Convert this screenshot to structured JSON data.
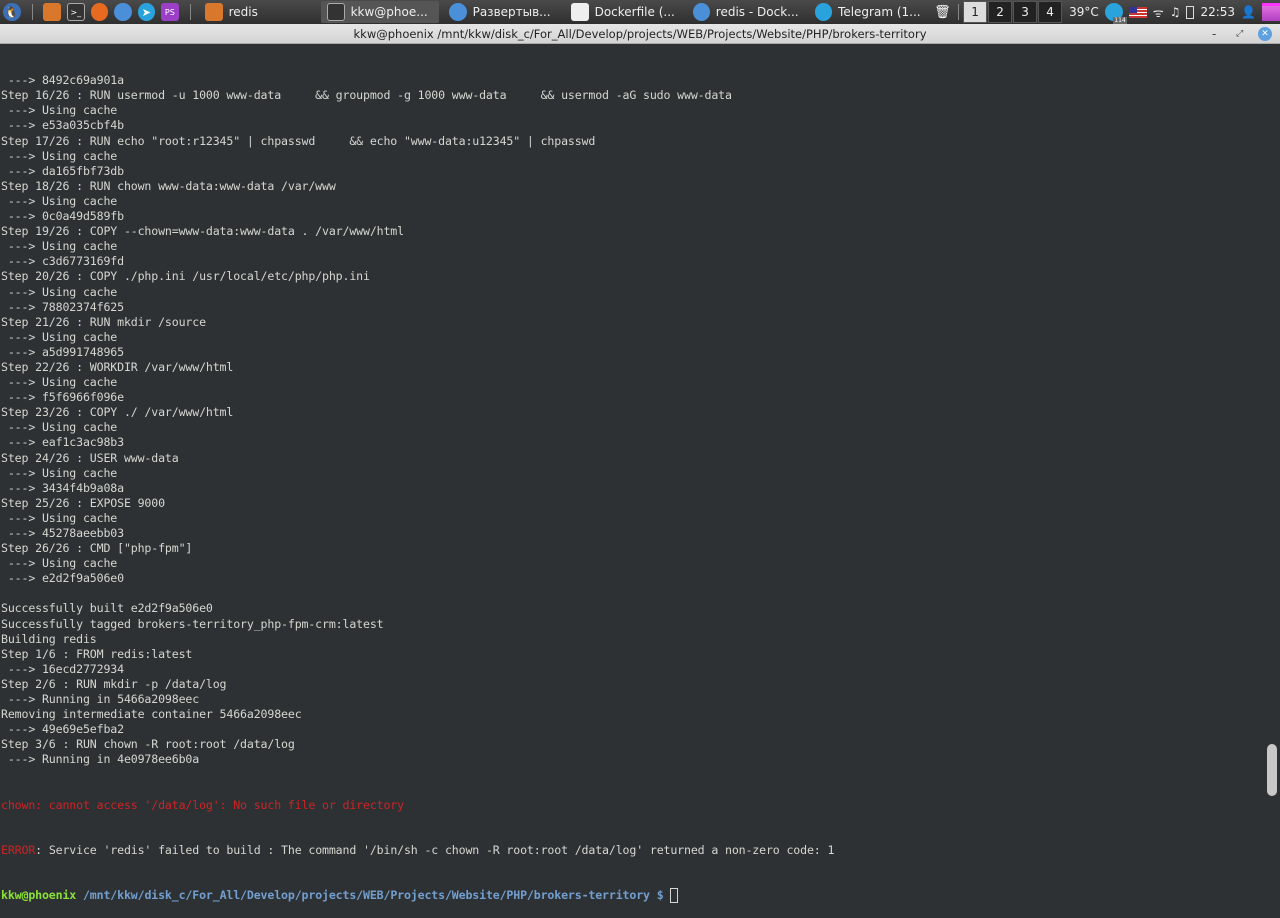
{
  "taskbar": {
    "tasks": [
      {
        "label": "redis",
        "icon": "folder-icon"
      },
      {
        "label": "kkw@phoe...",
        "icon": "terminal-icon",
        "active": true
      },
      {
        "label": "Развертыв...",
        "icon": "chromium-icon"
      },
      {
        "label": "Dockerfile (...",
        "icon": "text-editor-icon"
      },
      {
        "label": "redis - Dock...",
        "icon": "chromium-icon"
      },
      {
        "label": "Telegram (1...",
        "icon": "telegram-icon"
      }
    ],
    "workspaces": [
      "1",
      "2",
      "3",
      "4"
    ],
    "current_workspace": "1",
    "temperature": "39°C",
    "telegram_badge": "114",
    "clock": "22:53"
  },
  "window": {
    "title": "kkw@phoenix /mnt/kkw/disk_c/For_All/Develop/projects/WEB/Projects/Website/PHP/brokers-territory"
  },
  "terminal": {
    "lines": [
      " ---> 8492c69a901a",
      "Step 16/26 : RUN usermod -u 1000 www-data     && groupmod -g 1000 www-data     && usermod -aG sudo www-data",
      " ---> Using cache",
      " ---> e53a035cbf4b",
      "Step 17/26 : RUN echo \"root:r12345\" | chpasswd     && echo \"www-data:u12345\" | chpasswd",
      " ---> Using cache",
      " ---> da165fbf73db",
      "Step 18/26 : RUN chown www-data:www-data /var/www",
      " ---> Using cache",
      " ---> 0c0a49d589fb",
      "Step 19/26 : COPY --chown=www-data:www-data . /var/www/html",
      " ---> Using cache",
      " ---> c3d6773169fd",
      "Step 20/26 : COPY ./php.ini /usr/local/etc/php/php.ini",
      " ---> Using cache",
      " ---> 78802374f625",
      "Step 21/26 : RUN mkdir /source",
      " ---> Using cache",
      " ---> a5d991748965",
      "Step 22/26 : WORKDIR /var/www/html",
      " ---> Using cache",
      " ---> f5f6966f096e",
      "Step 23/26 : COPY ./ /var/www/html",
      " ---> Using cache",
      " ---> eaf1c3ac98b3",
      "Step 24/26 : USER www-data",
      " ---> Using cache",
      " ---> 3434f4b9a08a",
      "Step 25/26 : EXPOSE 9000",
      " ---> Using cache",
      " ---> 45278aeebb03",
      "Step 26/26 : CMD [\"php-fpm\"]",
      " ---> Using cache",
      " ---> e2d2f9a506e0",
      "",
      "Successfully built e2d2f9a506e0",
      "Successfully tagged brokers-territory_php-fpm-crm:latest",
      "Building redis",
      "Step 1/6 : FROM redis:latest",
      " ---> 16ecd2772934",
      "Step 2/6 : RUN mkdir -p /data/log",
      " ---> Running in 5466a2098eec",
      "Removing intermediate container 5466a2098eec",
      " ---> 49e69e5efba2",
      "Step 3/6 : RUN chown -R root:root /data/log",
      " ---> Running in 4e0978ee6b0a"
    ],
    "error_line": "chown: cannot access '/data/log': No such file or directory",
    "error_tag": "ERROR",
    "error_message": ": Service 'redis' failed to build : The command '/bin/sh -c chown -R root:root /data/log' returned a non-zero code: 1",
    "prompt_user": "kkw@phoenix",
    "prompt_path": " /mnt/kkw/disk_c/For_All/Develop/projects/WEB/Projects/Website/PHP/brokers-territory $ "
  },
  "colors": {
    "background": "#2e3134",
    "text": "#d3d7cf",
    "error": "#cc2424",
    "prompt_user": "#8ae234",
    "prompt_path": "#729fcf"
  }
}
